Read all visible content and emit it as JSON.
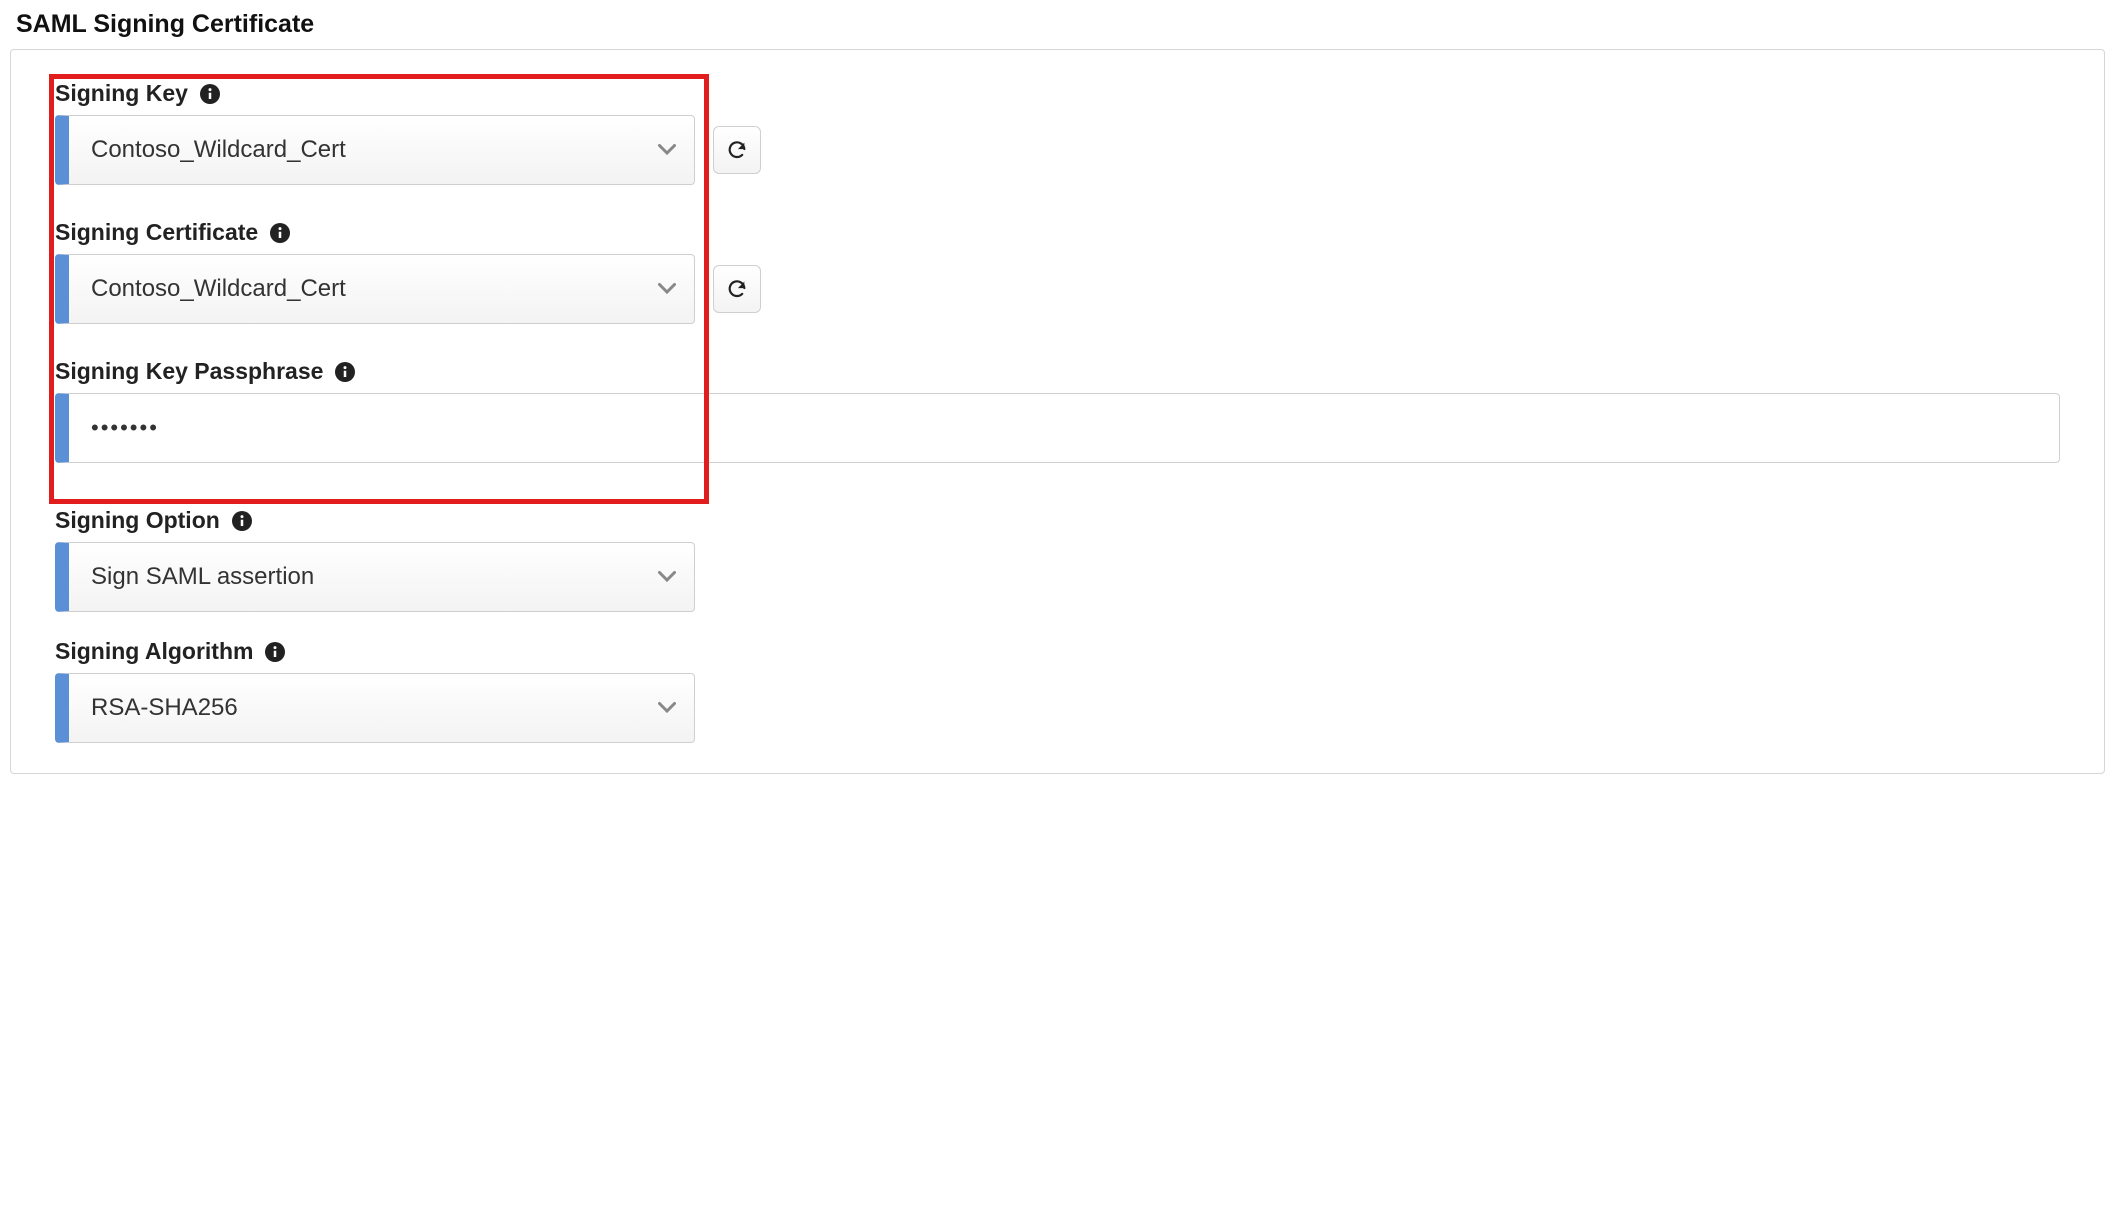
{
  "section": {
    "title": "SAML Signing Certificate"
  },
  "fields": {
    "signingKey": {
      "label": "Signing Key",
      "value": "Contoso_Wildcard_Cert"
    },
    "signingCertificate": {
      "label": "Signing Certificate",
      "value": "Contoso_Wildcard_Cert"
    },
    "signingKeyPassphrase": {
      "label": "Signing Key Passphrase",
      "masked": "•••••••"
    },
    "signingOption": {
      "label": "Signing Option",
      "value": "Sign SAML assertion"
    },
    "signingAlgorithm": {
      "label": "Signing Algorithm",
      "value": "RSA-SHA256"
    }
  }
}
